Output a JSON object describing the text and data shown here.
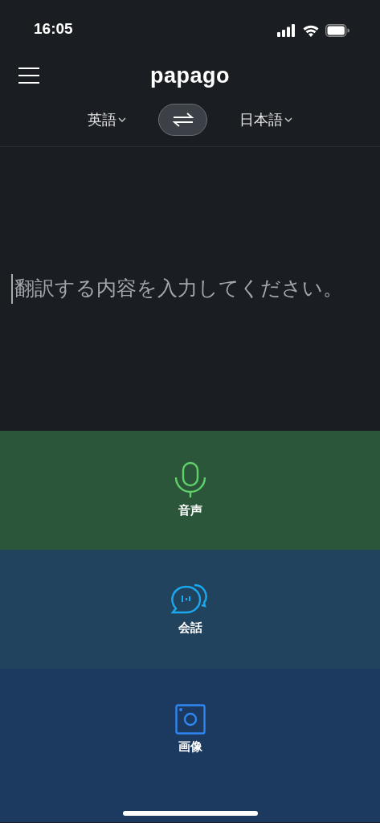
{
  "status_bar": {
    "time": "16:05"
  },
  "header": {
    "logo": "papago"
  },
  "languages": {
    "source": "英語",
    "target": "日本語"
  },
  "input": {
    "placeholder": "翻訳する内容を入力してください。"
  },
  "modes": [
    {
      "kind": "voice",
      "label": "音声"
    },
    {
      "kind": "conversation",
      "label": "会話"
    },
    {
      "kind": "image",
      "label": "画像"
    }
  ]
}
